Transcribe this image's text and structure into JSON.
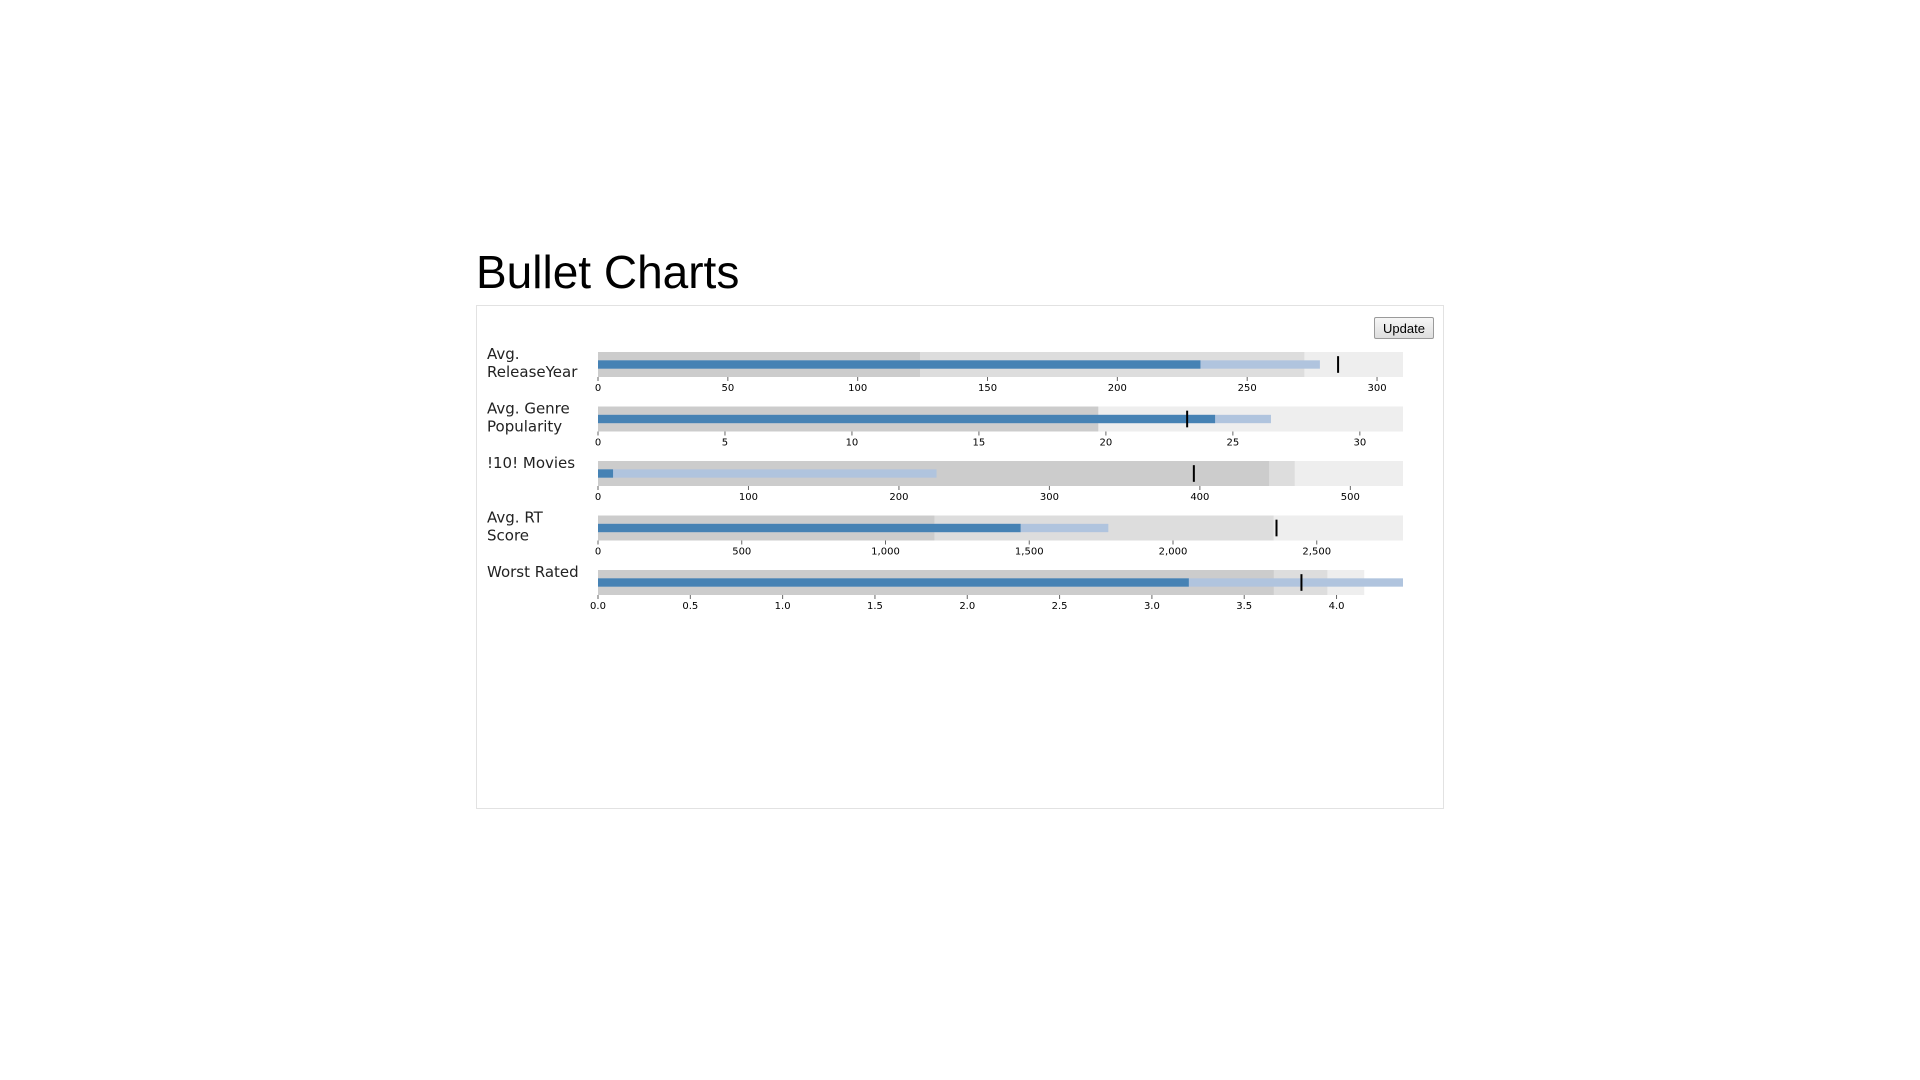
{
  "title": "Bullet Charts",
  "update_label": "Update",
  "colors": {
    "range_dark": "#cccccc",
    "range_mid": "#dddddd",
    "range_light": "#eeeeee",
    "measure_actual": "#4682b4",
    "measure_projected": "#b0c4de",
    "marker": "#000000"
  },
  "chart_data": [
    {
      "type": "bullet",
      "title_lines": [
        "Avg.",
        "ReleaseYear"
      ],
      "domain": [
        0,
        310
      ],
      "ranges": [
        124,
        272,
        310
      ],
      "measures": [
        232,
        278
      ],
      "marker": 285,
      "ticks": [
        0,
        50,
        100,
        150,
        200,
        250,
        300
      ],
      "tick_labels": [
        "0",
        "50",
        "100",
        "150",
        "200",
        "250",
        "300"
      ]
    },
    {
      "type": "bullet",
      "title_lines": [
        "Avg. Genre",
        "Popularity"
      ],
      "domain": [
        0,
        31.7
      ],
      "ranges": [
        19.7,
        31.7,
        31.7
      ],
      "measures": [
        24.3,
        26.5
      ],
      "marker": 23.2,
      "ticks": [
        0,
        5,
        10,
        15,
        20,
        25,
        30
      ],
      "tick_labels": [
        "0",
        "5",
        "10",
        "15",
        "20",
        "25",
        "30"
      ]
    },
    {
      "type": "bullet",
      "title_lines": [
        "!10! Movies"
      ],
      "domain": [
        0,
        535
      ],
      "ranges": [
        446,
        463,
        535
      ],
      "measures": [
        10,
        225
      ],
      "marker": 396,
      "ticks": [
        0,
        100,
        200,
        300,
        400,
        500
      ],
      "tick_labels": [
        "0",
        "100",
        "200",
        "300",
        "400",
        "500"
      ]
    },
    {
      "type": "bullet",
      "title_lines": [
        "Avg. RT",
        "Score"
      ],
      "domain": [
        0,
        2800
      ],
      "ranges": [
        1170,
        2350,
        2800
      ],
      "measures": [
        1470,
        1775
      ],
      "marker": 2360,
      "ticks": [
        0,
        500,
        1000,
        1500,
        2000,
        2500
      ],
      "tick_labels": [
        "0",
        "500",
        "1,000",
        "1,500",
        "2,000",
        "2,500"
      ]
    },
    {
      "type": "bullet",
      "title_lines": [
        "Worst Rated"
      ],
      "domain": [
        0,
        4.36
      ],
      "ranges": [
        3.66,
        3.95,
        4.15
      ],
      "measures": [
        3.2,
        4.36
      ],
      "marker": 3.81,
      "ticks": [
        0,
        0.5,
        1.0,
        1.5,
        2.0,
        2.5,
        3.0,
        3.5,
        4.0
      ],
      "tick_labels": [
        "0.0",
        "0.5",
        "1.0",
        "1.5",
        "2.0",
        "2.5",
        "3.0",
        "3.5",
        "4.0"
      ]
    }
  ]
}
